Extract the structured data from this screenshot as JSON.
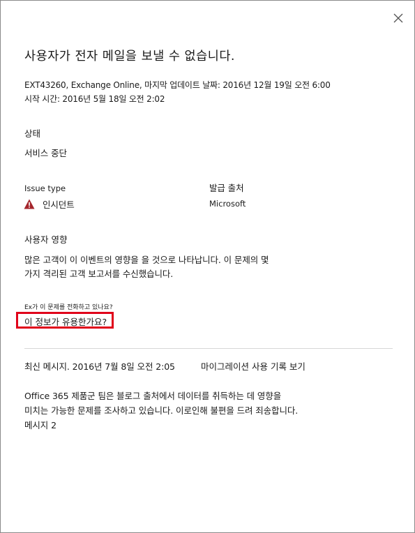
{
  "dialog": {
    "close_icon": "close-icon",
    "title": "사용자가 전자 메일을 보낼 수 없습니다.",
    "meta_line1": "EXT43260, Exchange Online, 마지막 업데이트 날짜: 2016년 12월 19일 오전 6:00",
    "meta_line2": "시작 시간: 2016년 5월 18일 오전 2:02"
  },
  "status": {
    "label": "상태",
    "value": "서비스 중단"
  },
  "issue_type": {
    "label": "Issue type",
    "icon": "warning-icon",
    "icon_color": "#a4262c",
    "value": "인시던트"
  },
  "origin": {
    "label": "발급 출처",
    "value": "Microsoft"
  },
  "user_impact": {
    "label": "사용자 영향",
    "line1": "많은 고객이 이 이벤트의 영향을 을 것으로 나타납니다. 이 문제의 몇",
    "line2": "가지 격리된 고객 보고서를 수신했습니다."
  },
  "feedback": {
    "question_small": "Ex가 이 문제를 전화하고 있나요?",
    "helpful_prompt": "이 정보가 유용한가요?",
    "highlight_color": "#e0001a"
  },
  "latest": {
    "label": "최신 메시지. 2016년 7월 8일 오전 2:05",
    "history_link": "마이그레이션 사용 기록 보기",
    "message_line1": "Office 365 제품군 팀은 블로그 출처에서 데이터를 취득하는 데 영향을",
    "message_line2": "미치는 가능한 문제를 조사하고 있습니다. 이로인해 불편을 드려 죄송합니다.",
    "message_line3": "메시지 2"
  }
}
